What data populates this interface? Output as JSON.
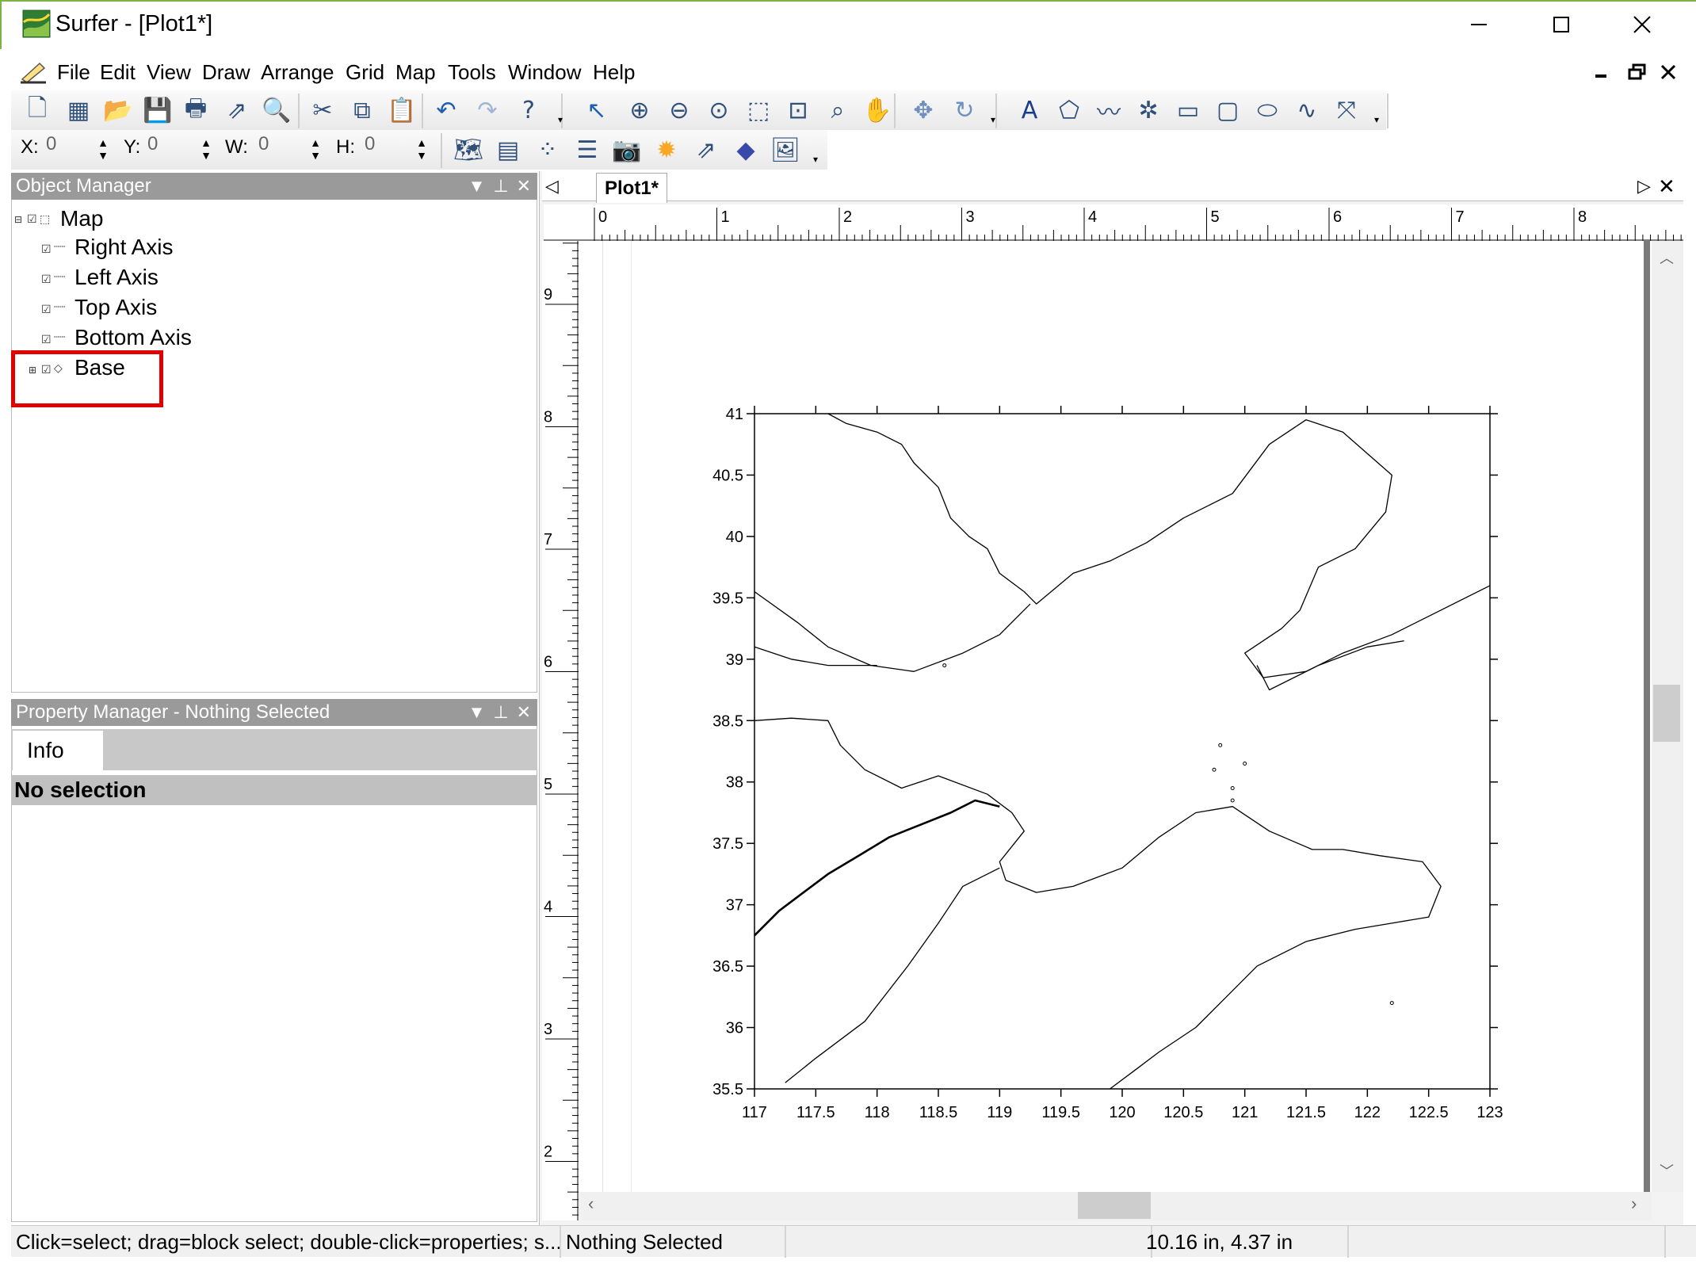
{
  "window": {
    "title": "Surfer - [Plot1*]",
    "controls": {
      "minimize": "minimize-icon",
      "maximize": "maximize-icon",
      "close": "close-icon"
    }
  },
  "menu": {
    "items": [
      "File",
      "Edit",
      "View",
      "Draw",
      "Arrange",
      "Grid",
      "Map",
      "Tools",
      "Window",
      "Help"
    ]
  },
  "toolbar_row1": {
    "icons": [
      "new-plot-icon",
      "new-worksheet-icon",
      "open-icon",
      "save-icon",
      "print-icon",
      "export-icon",
      "print-preview-icon",
      "cut-icon",
      "copy-icon",
      "paste-icon",
      "undo-icon",
      "redo-icon",
      "context-help-icon",
      "select-arrow-icon",
      "zoom-in-icon",
      "zoom-out-icon",
      "zoom-rectangle-icon",
      "zoom-page-icon",
      "zoom-selected-icon",
      "zoom-fit-icon",
      "pan-hand-icon",
      "rotate-3d-icon",
      "refresh-icon",
      "text-icon",
      "polygon-icon",
      "polyline-icon",
      "symbol-icon",
      "rectangle-icon",
      "rounded-rectangle-icon",
      "ellipse-icon",
      "spline-icon",
      "reshape-icon"
    ]
  },
  "toolbar_row2": {
    "x_label": "X:",
    "x_value": "0",
    "y_label": "Y:",
    "y_value": "0",
    "w_label": "W:",
    "w_value": "0",
    "h_label": "H:",
    "h_value": "0",
    "icons": [
      "base-map-icon",
      "contour-map-icon",
      "post-map-icon",
      "classed-post-icon",
      "image-map-icon",
      "shaded-relief-icon",
      "vector-map-icon",
      "3d-surface-icon",
      "base-image-icon"
    ]
  },
  "object_manager": {
    "title": "Object Manager",
    "tree": [
      {
        "label": "Map",
        "level": 0
      },
      {
        "label": "Right Axis",
        "level": 1
      },
      {
        "label": "Left Axis",
        "level": 1
      },
      {
        "label": "Top Axis",
        "level": 1
      },
      {
        "label": "Bottom Axis",
        "level": 1
      },
      {
        "label": "Base",
        "level": 1,
        "highlighted": true
      }
    ]
  },
  "property_manager": {
    "title": "Property Manager - Nothing Selected",
    "tab": "Info",
    "header": "No selection"
  },
  "document": {
    "tab_label": "Plot1*",
    "ruler_top": [
      "0",
      "1",
      "2",
      "3",
      "4",
      "5",
      "6",
      "7",
      "8"
    ],
    "ruler_left": [
      "9",
      "8",
      "7",
      "6",
      "5",
      "4",
      "3",
      "2"
    ]
  },
  "map": {
    "y_ticks": [
      "41",
      "40.5",
      "40",
      "39.5",
      "39",
      "38.5",
      "38",
      "37.5",
      "37",
      "36.5",
      "36",
      "35.5"
    ],
    "x_ticks": [
      "117",
      "117.5",
      "118",
      "118.5",
      "119",
      "119.5",
      "120",
      "120.5",
      "121",
      "121.5",
      "122",
      "122.5",
      "123"
    ],
    "x_range": [
      117,
      123
    ],
    "y_range": [
      35.5,
      41
    ]
  },
  "status": {
    "hint": "Click=select; drag=block select; double-click=properties; s...",
    "selection": "Nothing Selected",
    "empty": "",
    "cursor": "10.16 in, 4.37 in"
  },
  "colors": {
    "highlight_box": "#e00000",
    "pane_title": "#9a9a9a",
    "window_border": "#7cb342"
  }
}
